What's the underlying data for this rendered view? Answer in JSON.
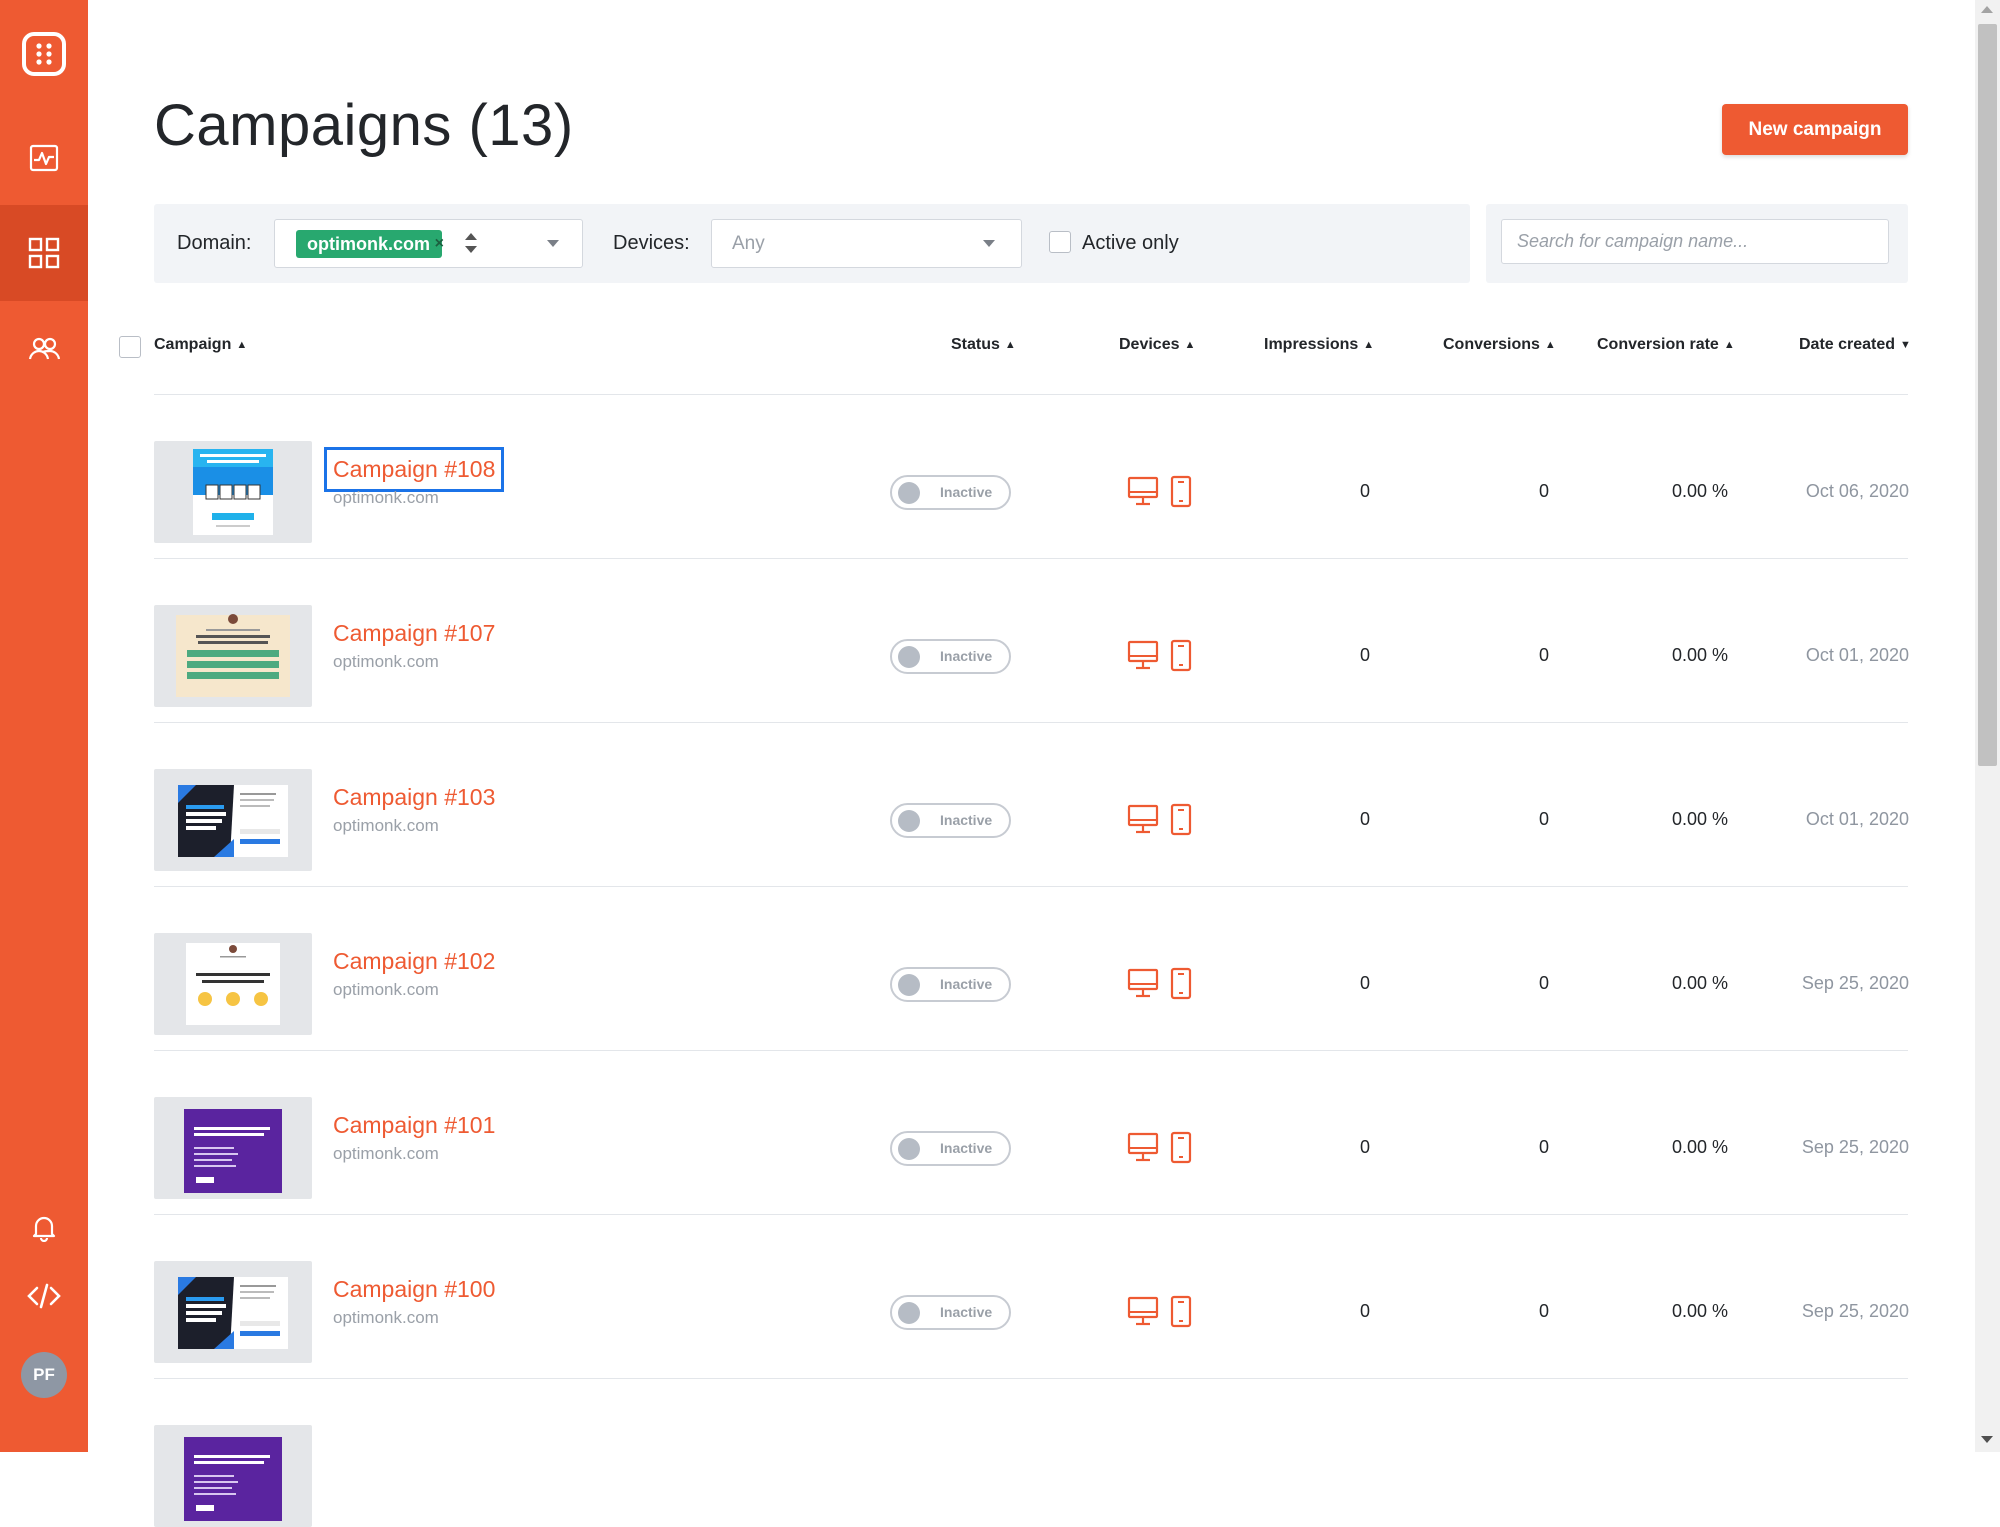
{
  "sidebar": {
    "items": [
      {
        "icon": "logo-grid-icon"
      },
      {
        "icon": "analytics-icon"
      },
      {
        "icon": "campaigns-grid-icon",
        "active": true
      },
      {
        "icon": "users-icon"
      },
      {
        "icon": "bell-icon"
      },
      {
        "icon": "code-icon"
      }
    ],
    "avatar": "PF"
  },
  "header": {
    "title": "Campaigns (13)",
    "new_button": "New campaign"
  },
  "filters": {
    "domain_label": "Domain:",
    "domain_tag": "optimonk.com",
    "domain_tag_remove": "×",
    "devices_label": "Devices:",
    "devices_value": "Any",
    "active_only_label": "Active only",
    "search_placeholder": "Search for campaign name..."
  },
  "table": {
    "columns": [
      "Campaign",
      "Status",
      "Devices",
      "Impressions",
      "Conversions",
      "Conversion rate",
      "Date created"
    ],
    "sorted_column": "Date created",
    "rows": [
      {
        "name": "Campaign #108",
        "domain": "optimonk.com",
        "status": "Inactive",
        "impressions": "0",
        "conversions": "0",
        "rate": "0.00 %",
        "date": "Oct 06, 2020",
        "thumb": "discount"
      },
      {
        "name": "Campaign #107",
        "domain": "optimonk.com",
        "status": "Inactive",
        "impressions": "0",
        "conversions": "0",
        "rate": "0.00 %",
        "date": "Oct 01, 2020",
        "thumb": "survey"
      },
      {
        "name": "Campaign #103",
        "domain": "optimonk.com",
        "status": "Inactive",
        "impressions": "0",
        "conversions": "0",
        "rate": "0.00 %",
        "date": "Oct 01, 2020",
        "thumb": "join"
      },
      {
        "name": "Campaign #102",
        "domain": "optimonk.com",
        "status": "Inactive",
        "impressions": "0",
        "conversions": "0",
        "rate": "0.00 %",
        "date": "Sep 25, 2020",
        "thumb": "feedback"
      },
      {
        "name": "Campaign #101",
        "domain": "optimonk.com",
        "status": "Inactive",
        "impressions": "0",
        "conversions": "0",
        "rate": "0.00 %",
        "date": "Sep 25, 2020",
        "thumb": "purple"
      },
      {
        "name": "Campaign #100",
        "domain": "optimonk.com",
        "status": "Inactive",
        "impressions": "0",
        "conversions": "0",
        "rate": "0.00 %",
        "date": "Sep 25, 2020",
        "thumb": "join"
      }
    ]
  },
  "colors": {
    "brand": "#ee5a32",
    "sidebar_active": "#d84a25",
    "tag_green": "#28a86f",
    "focus_outline": "#1b73e8"
  }
}
